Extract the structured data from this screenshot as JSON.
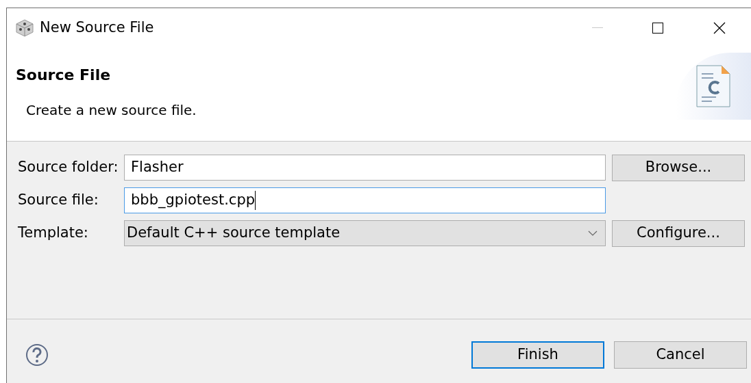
{
  "window": {
    "title": "New Source File"
  },
  "header": {
    "title": "Source File",
    "description": "Create a new source file."
  },
  "fields": [
    {
      "kind": "text",
      "label": "Source folder:",
      "value": "Flasher",
      "focused": false,
      "button": "Browse..."
    },
    {
      "kind": "text",
      "label": "Source file:",
      "value": "bbb_gpiotest.cpp",
      "focused": true
    },
    {
      "kind": "combo",
      "label": "Template:",
      "value": "Default C++ source template",
      "focused": false,
      "button": "Configure..."
    }
  ],
  "buttons": [
    {
      "label": "Finish",
      "default": true
    },
    {
      "label": "Cancel",
      "default": false
    }
  ]
}
